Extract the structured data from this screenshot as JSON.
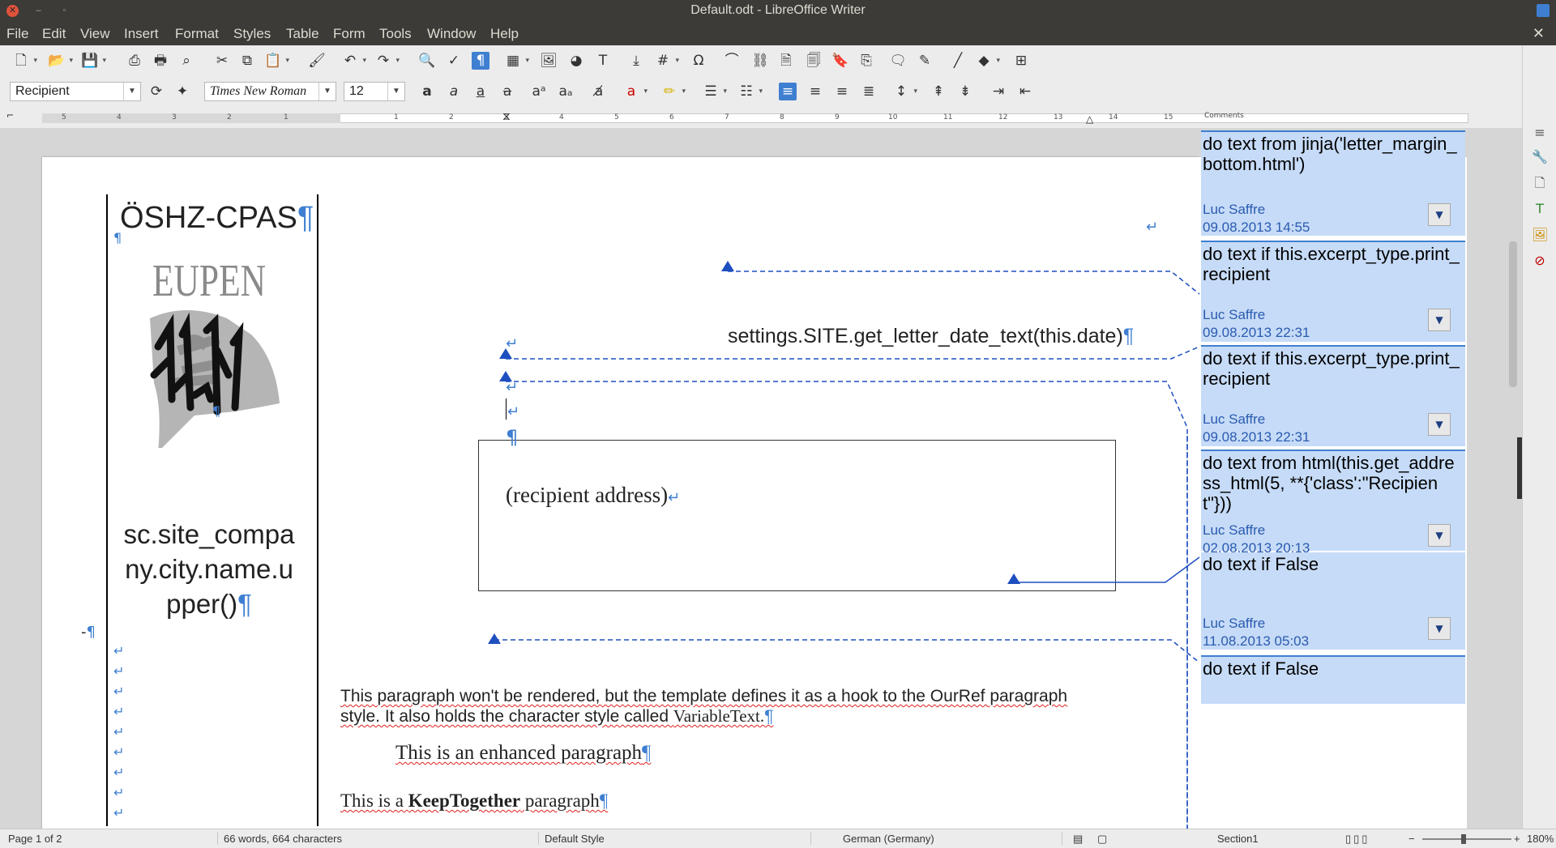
{
  "window": {
    "title": "Default.odt - LibreOffice Writer"
  },
  "menu": [
    "File",
    "Edit",
    "View",
    "Insert",
    "Format",
    "Styles",
    "Table",
    "Form",
    "Tools",
    "Window",
    "Help"
  ],
  "format_bar": {
    "paragraph_style": "Recipient",
    "font_name": "Times New Roman",
    "font_size": "12"
  },
  "ruler": {
    "ticks": [
      "5",
      "4",
      "3",
      "2",
      "1",
      "1",
      "2",
      "3",
      "4",
      "5",
      "6",
      "7",
      "8",
      "9",
      "10",
      "11",
      "12",
      "13",
      "14",
      "15"
    ],
    "comments_label": "Comments"
  },
  "document": {
    "org_name": "ÖSHZ-CPAS",
    "logo_text": "EUPEN",
    "company_expr_lines": [
      "sc.site_compa",
      "ny.city.name.u",
      "pper()"
    ],
    "date_expr": "settings.SITE.get_letter_date_text(this.date)",
    "recipient_address": "(recipient address)",
    "para1_a": "This paragraph won't be rendered, but the template defines it as a hook to the OurRef paragraph style. It also holds the character style called ",
    "para1_b": "VariableText.",
    "para2": "This is an enhanced paragraph",
    "para3_a": "This is a ",
    "para3_b": "KeepTogether",
    "para3_c": " paragraph",
    "pilcrow": "¶",
    "return_mark": "↵",
    "dash_marker": "-"
  },
  "comments": [
    {
      "body": "do text from jinja('letter_margin_bottom.html')",
      "author": "Luc Saffre",
      "date": "09.08.2013 14:55"
    },
    {
      "body": "do text if this.excerpt_type.print_recipient",
      "author": "Luc Saffre",
      "date": "09.08.2013 22:31"
    },
    {
      "body": "do text if this.excerpt_type.print_recipient",
      "author": "Luc Saffre",
      "date": "09.08.2013 22:31"
    },
    {
      "body": "do text from html(this.get_address_html(5, **{'class':\"Recipient\"}))",
      "author": "Luc Saffre",
      "date": "02.08.2013 20:13"
    },
    {
      "body": "do text if False",
      "author": "Luc Saffre",
      "date": "11.08.2013 05:03"
    },
    {
      "body": "do text if False",
      "author": "",
      "date": ""
    }
  ],
  "status": {
    "page": "Page 1 of 2",
    "words": "66 words, 664 characters",
    "page_style": "Default Style",
    "language": "German (Germany)",
    "section": "Section1",
    "zoom": "180%"
  },
  "colors": {
    "accent": "#3f7fd1",
    "comment_bg": "#c6dbf7",
    "anchor": "#1e4fbf",
    "spell_error": "#e02020"
  }
}
